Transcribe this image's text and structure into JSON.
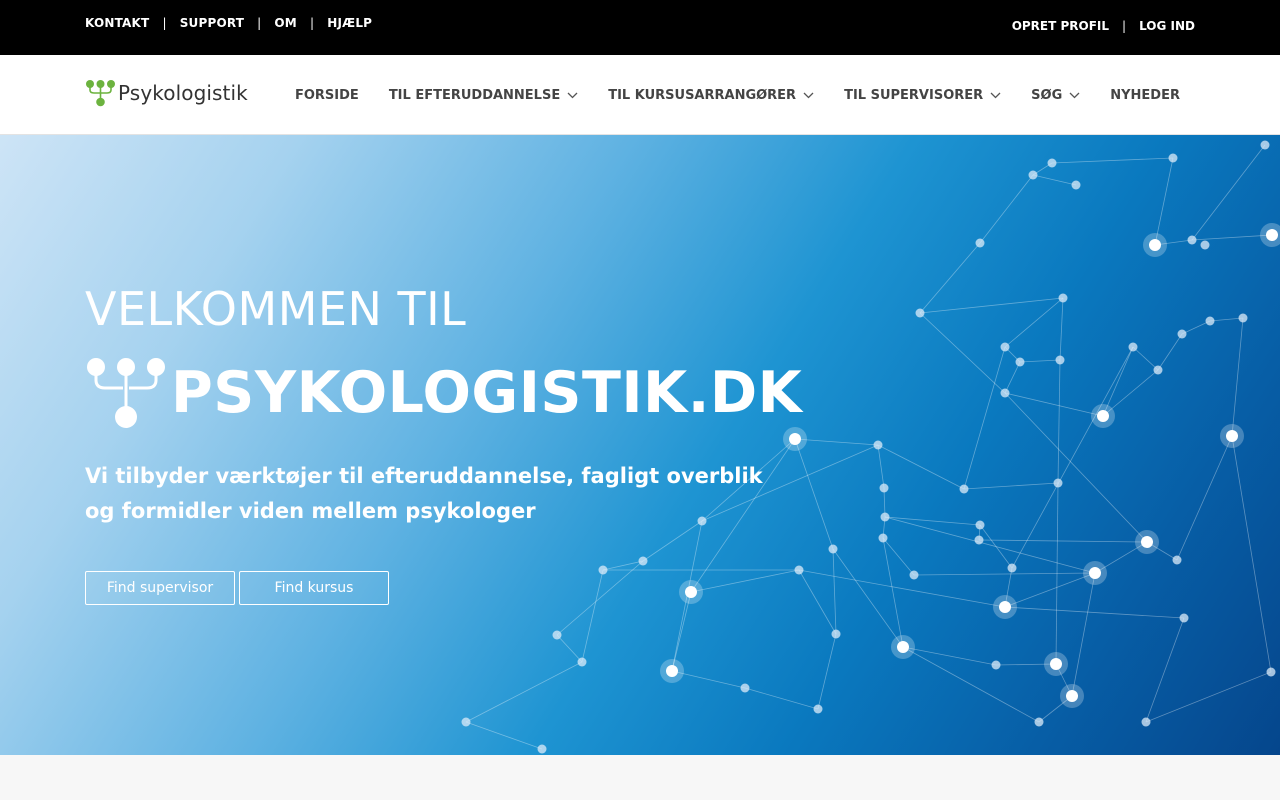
{
  "topbar": {
    "links": [
      "KONTAKT",
      "SUPPORT",
      "OM",
      "HJÆLP"
    ],
    "separator": "|",
    "right_links": [
      "OPRET PROFIL",
      "LOG IND"
    ]
  },
  "brand": {
    "name": "Psykologistik",
    "accent_color": "#6cb33f"
  },
  "nav": {
    "items": [
      {
        "label": "FORSIDE",
        "dropdown": false
      },
      {
        "label": "TIL EFTERUDDANNELSE",
        "dropdown": true
      },
      {
        "label": "TIL KURSUSARRANGØRER",
        "dropdown": true
      },
      {
        "label": "TIL SUPERVISORER",
        "dropdown": true
      },
      {
        "label": "SØG",
        "dropdown": true
      },
      {
        "label": "NYHEDER",
        "dropdown": false
      }
    ]
  },
  "hero": {
    "title": "VELKOMMEN TIL",
    "brand": "PSYKOLOGISTIK.DK",
    "subtitle_lines": [
      "Vi tilbyder værktøjer til efteruddannelse, fagligt overblik",
      "og formidler viden mellem psykologer"
    ],
    "buttons": [
      "Find supervisor",
      "Find kursus"
    ]
  }
}
